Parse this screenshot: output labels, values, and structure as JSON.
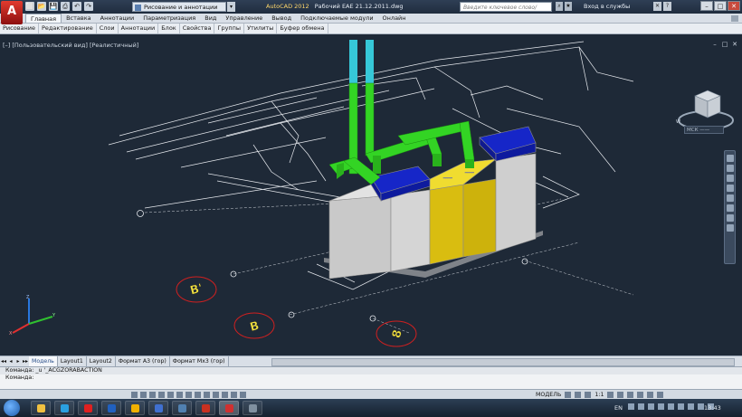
{
  "app": {
    "logo_letter": "A",
    "title_app": "AutoCAD 2012",
    "title_doc": "Рабочий ЕАЕ 21.12.2011.dwg"
  },
  "qat": [
    "⬜",
    "📂",
    "💾",
    "⎙",
    "↶",
    "↷"
  ],
  "workspace": {
    "label": "Рисование и аннотации",
    "dropdown": "▾"
  },
  "search": {
    "placeholder": "Введите ключевое слово/фразу"
  },
  "login": {
    "label": "Вход в службы"
  },
  "window_controls": {
    "minimize": "–",
    "maximize": "□",
    "close": "✕"
  },
  "ribbon_tabs": [
    "Главная",
    "Вставка",
    "Аннотации",
    "Параметризация",
    "Вид",
    "Управление",
    "Вывод",
    "Подключаемые модули",
    "Онлайн"
  ],
  "ribbon_panels": [
    "Рисование",
    "Редактирование",
    "Слои",
    "Аннотации",
    "Блок",
    "Свойства",
    "Группы",
    "Утилиты",
    "Буфер обмена"
  ],
  "viewport": {
    "label": "[–] [Пользовательский вид] [Реалистичный]",
    "controls": {
      "minimize": "–",
      "restore": "□",
      "close": "✕"
    },
    "wcs_label": "МСК ——"
  },
  "grid_bubbles": [
    "В'",
    "В",
    "8"
  ],
  "layout_tabs": {
    "nav": [
      "◂◂",
      "◂",
      "▸",
      "▸▸"
    ],
    "tabs": [
      "Модель",
      "Layout1",
      "Layout2",
      "Формат А3 (гор)",
      "Формат Мх3 (гор)"
    ],
    "active_index": 0
  },
  "command": {
    "line1": "Команда:  _u  '_ACGZORABACTION",
    "line2": "Команда:"
  },
  "status": {
    "model_label": "МОДЕЛЬ",
    "scale_label": "1:1"
  },
  "taskbar": {
    "language": "EN",
    "clock": "13:43",
    "apps": [
      {
        "name": "explorer",
        "color": "#f0c040"
      },
      {
        "name": "media",
        "color": "#2aa0e0"
      },
      {
        "name": "opera",
        "color": "#e02020"
      },
      {
        "name": "outlook",
        "color": "#2060c0"
      },
      {
        "name": "chrome",
        "color": "#f0b000"
      },
      {
        "name": "app-blue",
        "color": "#4070d0"
      },
      {
        "name": "app-grid",
        "color": "#5080b0"
      },
      {
        "name": "pdf",
        "color": "#c83020"
      },
      {
        "name": "autocad",
        "color": "#d03030"
      },
      {
        "name": "app-gray",
        "color": "#8090a0"
      }
    ]
  },
  "colors": {
    "viewport_bg": "#1e2937",
    "pipe_green": "#33d424",
    "pipe_cyan": "#36c8d8",
    "cabinet_gray": "#c9c9c9",
    "cabinet_yellow": "#d9bd10",
    "cabinet_top_blue": "#1626c8",
    "bubble_red": "#d02020",
    "bubble_text": "#f0e040"
  }
}
